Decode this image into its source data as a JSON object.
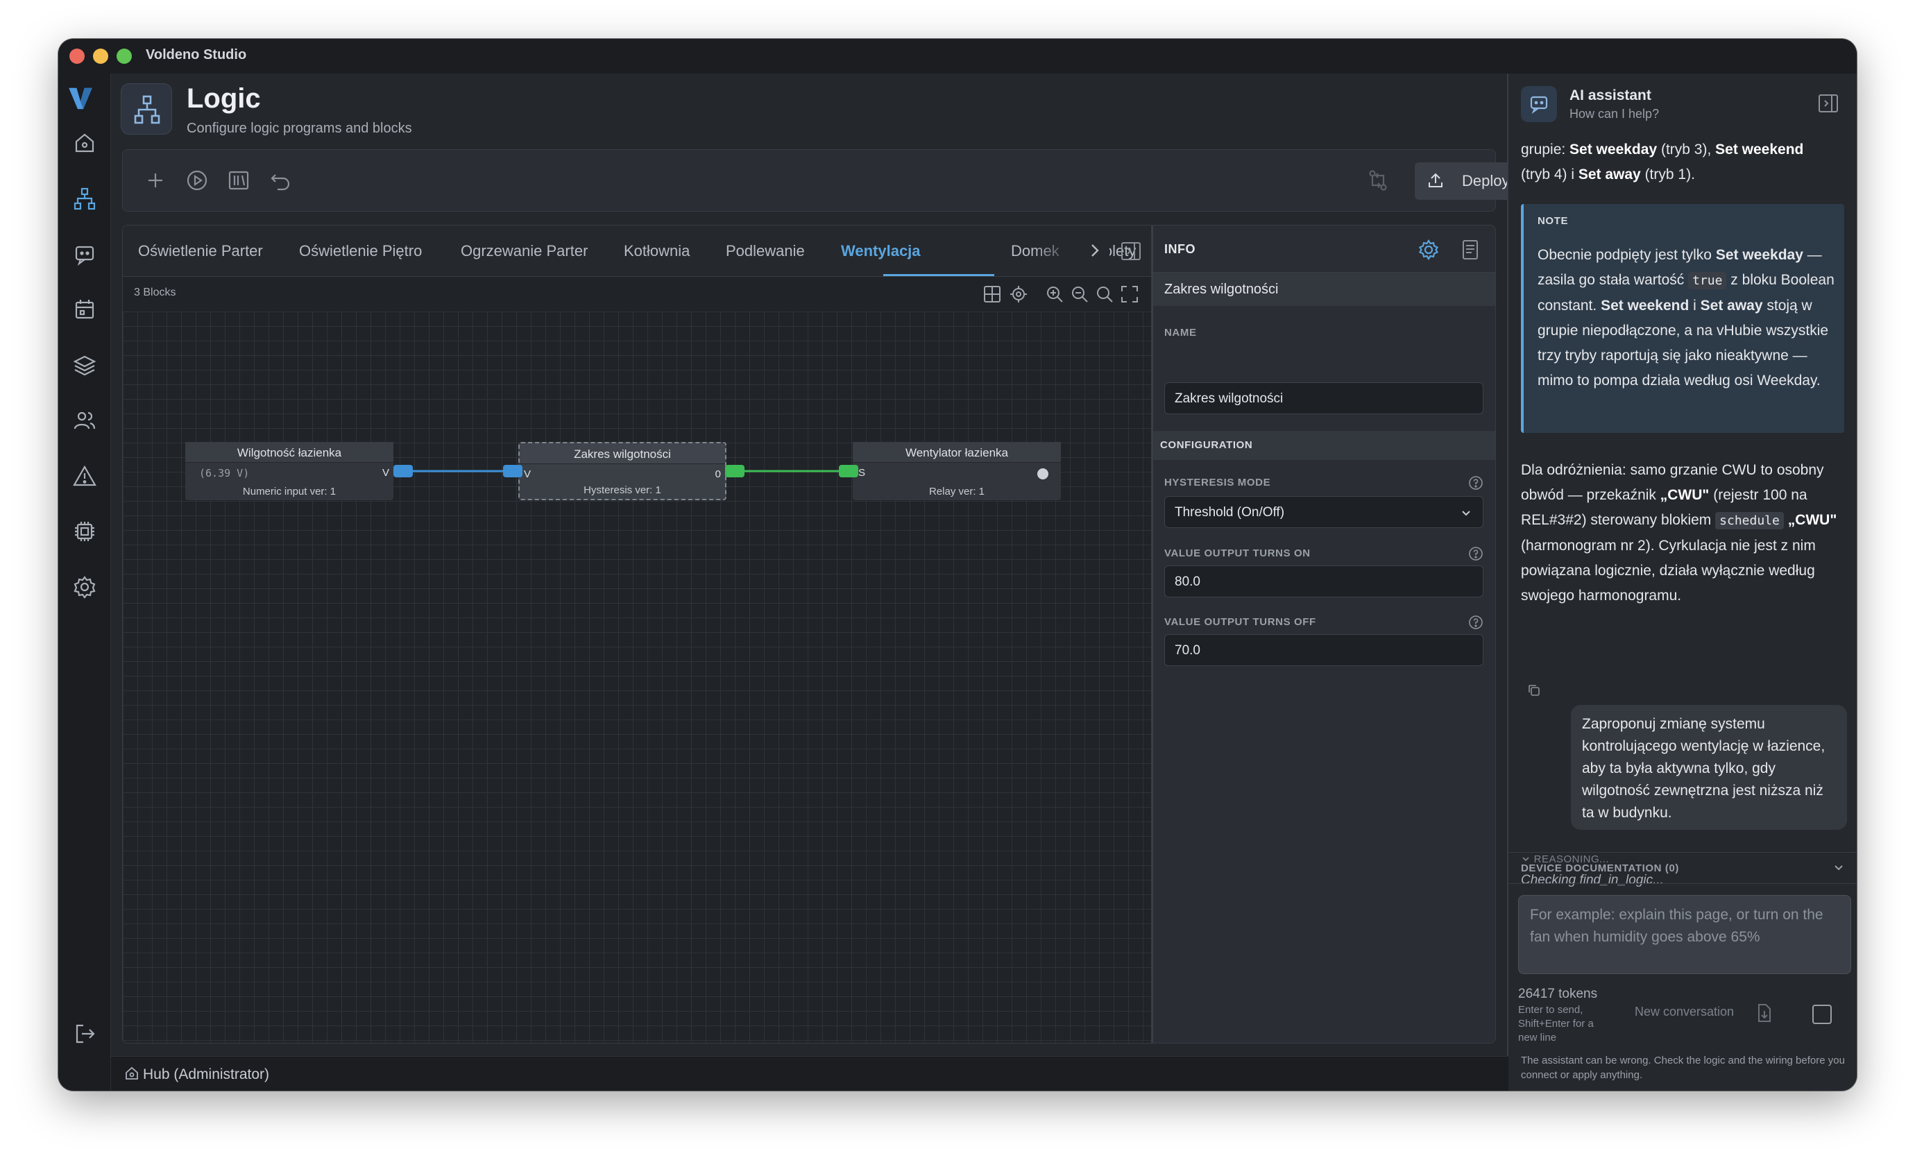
{
  "window": {
    "title": "Voldeno Studio"
  },
  "page": {
    "title": "Logic",
    "subtitle": "Configure logic programs and blocks"
  },
  "toolbar": {
    "deploy_label": "Deploy"
  },
  "tabs": [
    {
      "label": "Oświetlenie Parter"
    },
    {
      "label": "Oświetlenie Piętro"
    },
    {
      "label": "Ogrzewanie Parter"
    },
    {
      "label": "Kotłownia"
    },
    {
      "label": "Podlewanie"
    },
    {
      "label": "Wentylacja",
      "active": true
    },
    {
      "label": "Domek"
    },
    {
      "label": "Rolety"
    }
  ],
  "canvas": {
    "block_count": "3 Blocks",
    "nodes": [
      {
        "title": "Wilgotność łazienka",
        "value": "(6.39 V)",
        "subtitle": "Numeric input ver: 1",
        "out_port": "V"
      },
      {
        "title": "Zakres wilgotności",
        "subtitle": "Hysteresis ver: 1",
        "in_port": "V",
        "out_port": "0"
      },
      {
        "title": "Wentylator łazienka",
        "subtitle": "Relay ver: 1",
        "in_port": "S"
      }
    ],
    "colors": {
      "blue_link": "#3d8fd6",
      "green_link": "#3dbb55"
    }
  },
  "info": {
    "title": "INFO",
    "selected": "Zakres wilgotności",
    "name_label": "NAME",
    "name_value": "Zakres wilgotności",
    "config_label": "CONFIGURATION",
    "hysteresis_label": "HYSTERESIS MODE",
    "hysteresis_value": "Threshold (On/Off)",
    "turns_on_label": "VALUE OUTPUT TURNS ON",
    "turns_on_value": "80.0",
    "turns_off_label": "VALUE OUTPUT TURNS OFF",
    "turns_off_value": "70.0"
  },
  "assistant": {
    "title": "AI assistant",
    "subtitle": "How can I help?",
    "msg1": {
      "p1": "grupie: ",
      "b1": "Set weekday",
      "p2": " (tryb 3), ",
      "b2": "Set weekend",
      "p3": " ",
      "p3b": "(tryb 4) i ",
      "b3": "Set away",
      "p4": " (tryb 1)."
    },
    "note": {
      "label": "NOTE",
      "t1": "Obecnie podpięty jest tylko ",
      "b1": "Set weekday",
      "t2": " — zasila go stała wartość ",
      "code": "true",
      "t3": " z bloku Boolean constant. ",
      "b2": "Set weekend",
      "t4": " i ",
      "b3": "Set away",
      "t5": " stoją w grupie niepodłączone, a na vHubie wszystkie trzy tryby raportują się jako nieaktywne — mimo to pompa działa według osi Weekday."
    },
    "msg2": {
      "t1": "Dla odróżnienia: samo grzanie CWU to osobny obwód — przekaźnik ",
      "b1": "„CWU\"",
      "t2": " (rejestr 100 na REL#3#2) sterowany blokiem ",
      "code": "schedule",
      "b2": "„CWU\"",
      "t3": " (harmonogram nr 2). Cyrkulacja nie jest z nim powiązana logicznie, działa wyłącznie według swojego harmonogramu."
    },
    "user_msg": "Zaproponuj zmianę systemu kontrolującego wentylację w łazience, aby ta była aktywna tylko, gdy wilgotność zewnętrzna jest niższa niż ta w budynku.",
    "reasoning": "REASONING...",
    "checking": "Checking find_in_logic...",
    "device_doc": "DEVICE DOCUMENTATION (0)",
    "placeholder": "For example: explain this page, or turn on the fan when humidity goes above 65%",
    "tokens": "26417 tokens",
    "hint": "Enter to send, Shift+Enter for a new line",
    "new_conversation": "New conversation",
    "disclaimer": "The assistant can be wrong. Check the logic and the wiring before you connect or apply anything."
  },
  "status": {
    "hub": "Hub (Administrator)"
  }
}
